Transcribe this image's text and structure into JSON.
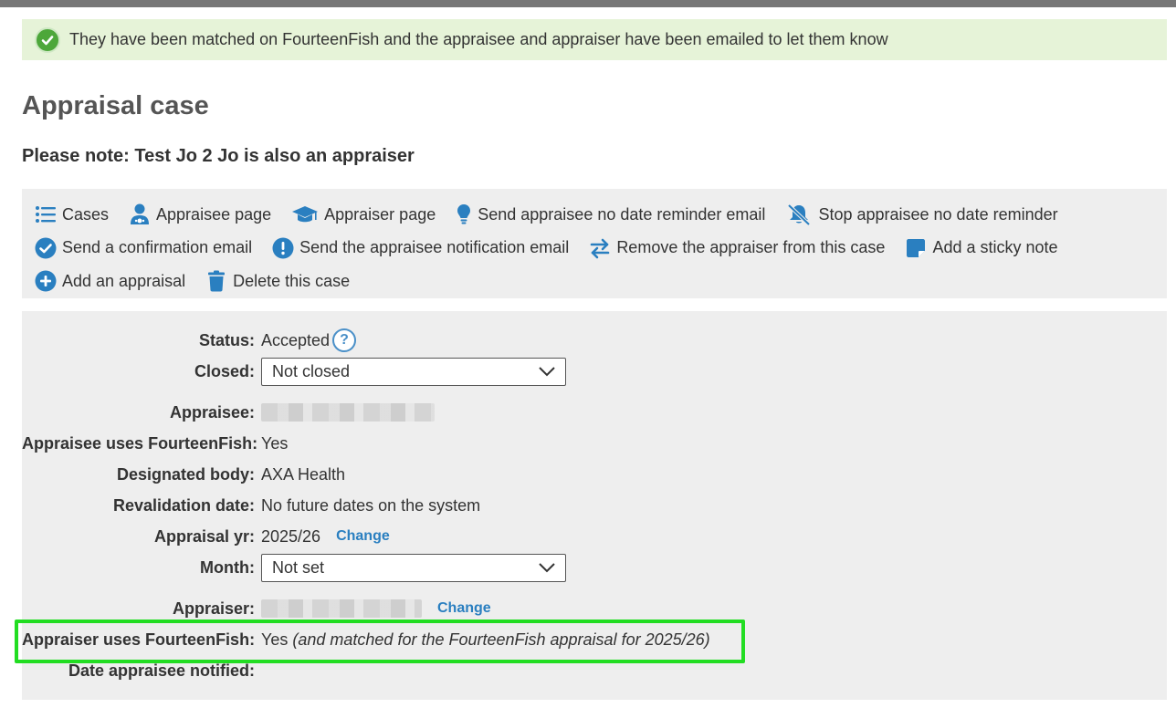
{
  "flash": {
    "message": "They have been matched on FourteenFish and the appraisee and appraiser have been emailed to let them know"
  },
  "page": {
    "title": "Appraisal case",
    "note": "Please note: Test Jo 2 Jo is also an appraiser"
  },
  "actions": {
    "row1": [
      {
        "label": "Cases",
        "icon": "list-icon"
      },
      {
        "label": "Appraisee page",
        "icon": "user-doctor-icon"
      },
      {
        "label": "Appraiser page",
        "icon": "graduation-cap-icon"
      },
      {
        "label": "Send appraisee no date reminder email",
        "icon": "lightbulb-icon"
      },
      {
        "label": "Stop appraisee no date reminder",
        "icon": "bell-slash-icon"
      }
    ],
    "row2": [
      {
        "label": "Send a confirmation email",
        "icon": "check-circle-icon"
      },
      {
        "label": "Send the appraisee notification email",
        "icon": "exclamation-circle-icon"
      },
      {
        "label": "Remove the appraiser from this case",
        "icon": "swap-arrows-icon"
      },
      {
        "label": "Add a sticky note",
        "icon": "sticky-note-icon"
      }
    ],
    "row3": [
      {
        "label": "Add an appraisal",
        "icon": "plus-circle-icon"
      },
      {
        "label": "Delete this case",
        "icon": "trash-icon"
      }
    ]
  },
  "details": {
    "status_label": "Status:",
    "status_value": "Accepted",
    "help_glyph": "?",
    "closed_label": "Closed:",
    "closed_value": "Not closed",
    "appraisee_label": "Appraisee:",
    "appraisee_uses_label": "Appraisee uses FourteenFish:",
    "appraisee_uses_value": "Yes",
    "designated_body_label": "Designated body:",
    "designated_body_value": "AXA Health",
    "revalidation_label": "Revalidation date:",
    "revalidation_value": "No future dates on the system",
    "appraisal_yr_label": "Appraisal yr:",
    "appraisal_yr_value": "2025/26",
    "change_label": "Change",
    "month_label": "Month:",
    "month_value": "Not set",
    "appraiser_label": "Appraiser:",
    "appraiser_uses_label": "Appraiser uses FourteenFish:",
    "appraiser_uses_value": "Yes",
    "appraiser_uses_note": "(and matched for the FourteenFish appraisal for 2025/26)",
    "date_notified_label": "Date appraisee notified:"
  },
  "colors": {
    "flash_bg": "#e6f3d8",
    "icon_blue": "#2a7fc0",
    "link_blue": "#2a7fc0",
    "highlight": "#22dd22"
  }
}
